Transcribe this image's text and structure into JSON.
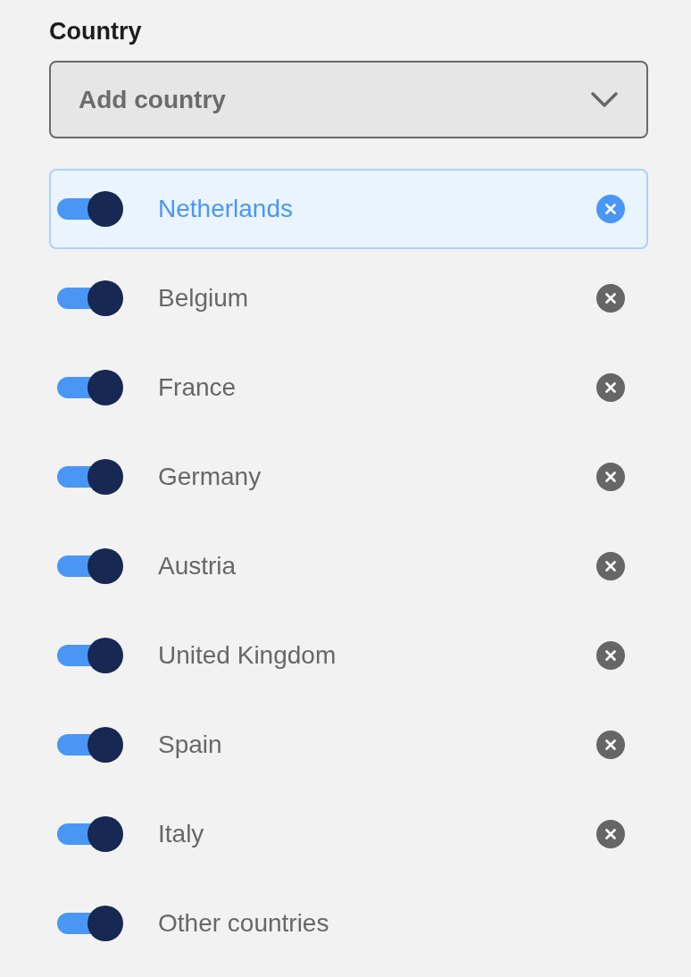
{
  "label": "Country",
  "dropdown": {
    "placeholder": "Add country"
  },
  "items": [
    {
      "name": "Netherlands",
      "on": true,
      "selected": true,
      "removable": true
    },
    {
      "name": "Belgium",
      "on": true,
      "selected": false,
      "removable": true
    },
    {
      "name": "France",
      "on": true,
      "selected": false,
      "removable": true
    },
    {
      "name": "Germany",
      "on": true,
      "selected": false,
      "removable": true
    },
    {
      "name": "Austria",
      "on": true,
      "selected": false,
      "removable": true
    },
    {
      "name": "United Kingdom",
      "on": true,
      "selected": false,
      "removable": true
    },
    {
      "name": "Spain",
      "on": true,
      "selected": false,
      "removable": true
    },
    {
      "name": "Italy",
      "on": true,
      "selected": false,
      "removable": true
    },
    {
      "name": "Other countries",
      "on": true,
      "selected": false,
      "removable": false
    }
  ]
}
